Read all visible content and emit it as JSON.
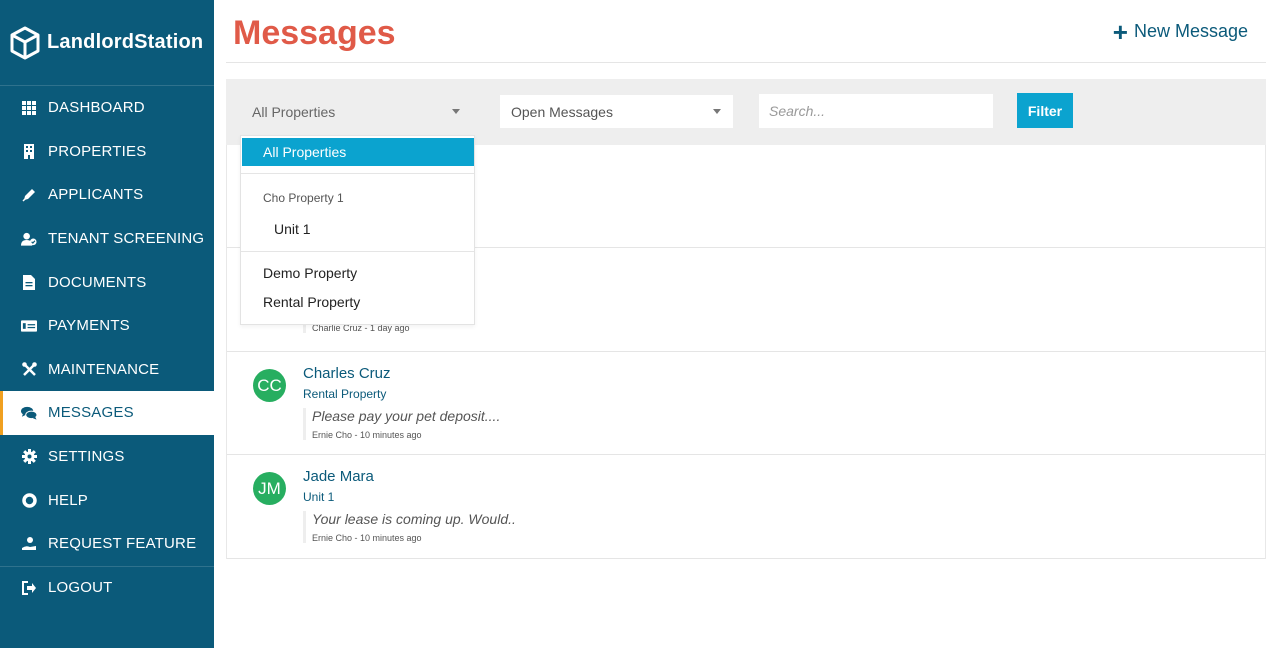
{
  "brand": {
    "name": "LandlordStation"
  },
  "sidebar": {
    "items": [
      {
        "label": "DASHBOARD",
        "icon": "grid-icon"
      },
      {
        "label": "PROPERTIES",
        "icon": "building-icon"
      },
      {
        "label": "APPLICANTS",
        "icon": "pen-icon"
      },
      {
        "label": "TENANT SCREENING",
        "icon": "user-check-icon"
      },
      {
        "label": "DOCUMENTS",
        "icon": "document-icon"
      },
      {
        "label": "PAYMENTS",
        "icon": "payment-card-icon"
      },
      {
        "label": "MAINTENANCE",
        "icon": "tools-icon"
      },
      {
        "label": "MESSAGES",
        "icon": "chat-icon",
        "active": true
      },
      {
        "label": "SETTINGS",
        "icon": "gear-icon"
      },
      {
        "label": "HELP",
        "icon": "lifebuoy-icon"
      },
      {
        "label": "REQUEST FEATURE",
        "icon": "hand-user-icon"
      },
      {
        "label": "LOGOUT",
        "icon": "logout-icon"
      }
    ]
  },
  "header": {
    "title": "Messages",
    "new_message": "New Message"
  },
  "filters": {
    "property_select": "All Properties",
    "status_select": "Open Messages",
    "search_placeholder": "Search...",
    "filter_button": "Filter"
  },
  "dropdown": {
    "selected": "All Properties",
    "group_label": "Cho Property 1",
    "group_option": "Unit 1",
    "options": [
      "Demo Property",
      "Rental Property"
    ]
  },
  "messages": [
    {
      "initials": "",
      "name": "",
      "property": "",
      "snippet": "",
      "meta": ""
    },
    {
      "initials": "",
      "name": "",
      "property": "",
      "snippet": "",
      "meta": "Charlie Cruz - 1 day ago"
    },
    {
      "initials": "CC",
      "name": "Charles Cruz",
      "property": "Rental Property",
      "snippet": "Please pay your pet deposit....",
      "meta": "Ernie Cho - 10 minutes ago"
    },
    {
      "initials": "JM",
      "name": "Jade Mara",
      "property": "Unit 1",
      "snippet": "Your lease is coming up. Would..",
      "meta": "Ernie Cho - 10 minutes ago"
    }
  ],
  "colors": {
    "sidebar": "#0b5a7a",
    "title": "#e05a48",
    "accent": "#0ba3cf",
    "avatar": "#27ae60",
    "active_marker": "#f0a020"
  }
}
